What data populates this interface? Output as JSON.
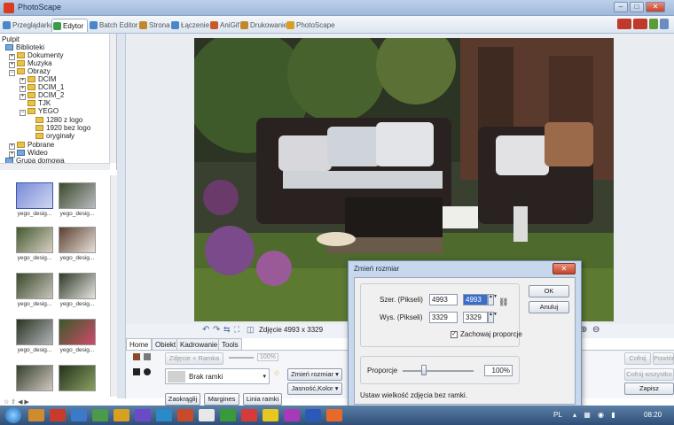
{
  "window": {
    "title": "PhotoScape",
    "controls": [
      "–",
      "□",
      "✕"
    ]
  },
  "tabs": [
    {
      "label": "Przeglądarka",
      "active": false,
      "color": "#4a86c8"
    },
    {
      "label": "Edytor",
      "active": true,
      "color": "#3a9a4c"
    },
    {
      "label": "Batch Editor",
      "active": false,
      "color": "#4a86c8"
    },
    {
      "label": "Strona",
      "active": false,
      "color": "#c0882a"
    },
    {
      "label": "Łączenie",
      "active": false,
      "color": "#4a86c8"
    },
    {
      "label": "AniGif",
      "active": false,
      "color": "#c85a2a"
    },
    {
      "label": "Drukowanie",
      "active": false,
      "color": "#c0882a"
    },
    {
      "label": "PhotoScape",
      "active": false,
      "color": "#d8a020"
    }
  ],
  "tree": {
    "root": "Pulpit",
    "items": [
      {
        "label": "Biblioteki",
        "level": 0,
        "icon": "library-icon"
      },
      {
        "label": "Dokumenty",
        "level": 1,
        "icon": "folder-icon"
      },
      {
        "label": "Muzyka",
        "level": 1,
        "icon": "folder-icon"
      },
      {
        "label": "Obrazy",
        "level": 1,
        "icon": "folder-icon"
      },
      {
        "label": "DCIM",
        "level": 2,
        "icon": "folder-icon"
      },
      {
        "label": "DCIM_1",
        "level": 2,
        "icon": "folder-icon"
      },
      {
        "label": "DCIM_2",
        "level": 2,
        "icon": "folder-icon"
      },
      {
        "label": "TJK",
        "level": 2,
        "icon": "folder-icon"
      },
      {
        "label": "YEGO",
        "level": 2,
        "icon": "folder-icon"
      },
      {
        "label": "1280 z logo",
        "level": 3,
        "icon": "folder-icon"
      },
      {
        "label": "1920 bez logo",
        "level": 3,
        "icon": "folder-icon"
      },
      {
        "label": "oryginały",
        "level": 3,
        "icon": "folder-icon"
      },
      {
        "label": "Pobrane",
        "level": 1,
        "icon": "folder-icon"
      },
      {
        "label": "Wideo",
        "level": 1,
        "icon": "folder-icon"
      },
      {
        "label": "Grupa domowa",
        "level": 0,
        "icon": "homegroup-icon"
      }
    ]
  },
  "thumbnails": {
    "captions": [
      "yego_desig...",
      "yego_desig...",
      "yego_desig...",
      "yego_desig...",
      "yego_desig...",
      "yego_desig...",
      "yego_desig...",
      "yego_desig..."
    ]
  },
  "infobar": {
    "size_text": "Zdjęcie 4993 x 3329"
  },
  "edit_tabs": [
    "Home",
    "Obiekt",
    "Kadrowanie",
    "Tools"
  ],
  "edit_panel": {
    "photo_frame_label": "Zdjęcie + Ramka",
    "zoom_percent": "100%",
    "frame_select": "Brak ramki",
    "resize_label": "Zmień rozmiar",
    "brightness_label": "Jasność,Kolor",
    "crop_label": "Zaokrąglij",
    "margins_label": "Margines",
    "frame_lines_label": "Linia ramki"
  },
  "right_buttons": {
    "undo": "Cofnij",
    "redo": "Powtórz",
    "undo_all": "Cofnij wszystko",
    "save": "Zapisz"
  },
  "dialog": {
    "title": "Zmień rozmiar",
    "width_label": "Szer. (Pikseli)",
    "width_orig": "4993",
    "width_value": "4993",
    "height_label": "Wys. (Pikseli)",
    "height_orig": "3329",
    "height_value": "3329",
    "keep_ratio_label": "Zachowaj proporcje",
    "keep_ratio_checked": true,
    "ok_label": "OK",
    "cancel_label": "Anuluj",
    "proportion_label": "Proporcje",
    "proportion_value": "100%",
    "proportion_level": 0.3,
    "hint": "Ustaw wielkość zdjęcia bez ramki."
  },
  "taskbar": {
    "time": "08:20",
    "lang": "PL"
  }
}
